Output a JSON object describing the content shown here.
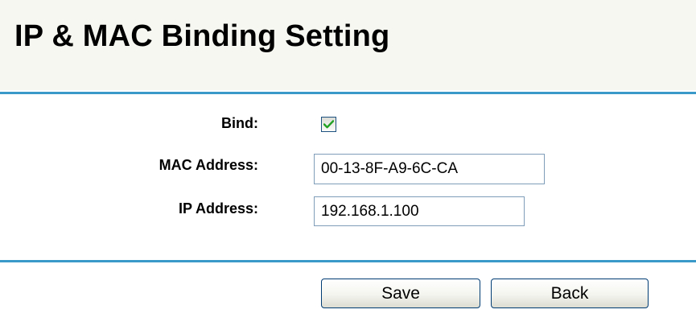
{
  "page": {
    "title": "IP & MAC Binding Setting"
  },
  "form": {
    "bind": {
      "label": "Bind:",
      "checked": true
    },
    "mac_address": {
      "label": "MAC Address:",
      "value": "00-13-8F-A9-6C-CA"
    },
    "ip_address": {
      "label": "IP Address:",
      "value": "192.168.1.100"
    }
  },
  "buttons": {
    "save": "Save",
    "back": "Back"
  },
  "colors": {
    "rule": "#3b99c9",
    "header_bg": "#f7f7f1",
    "checkmark": "#21a121"
  }
}
